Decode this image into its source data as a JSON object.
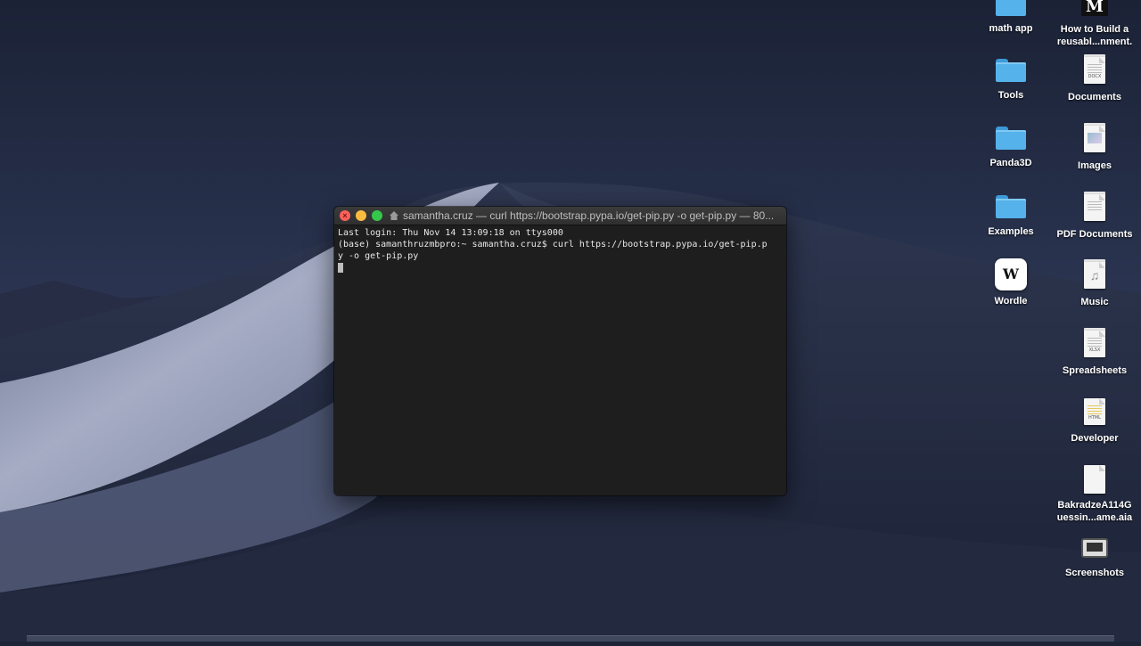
{
  "colors": {
    "sky_top": "#1b2236",
    "dune_light": "#8f98b3",
    "folder_blue": "#55b2ea",
    "terminal_bg": "#1e1e1e"
  },
  "terminal": {
    "title": "samantha.cruz — curl https://bootstrap.pypa.io/get-pip.py -o get-pip.py — 80...",
    "lines": [
      "Last login: Thu Nov 14 13:09:18 on ttys000",
      "(base) samanthruzmbpro:~ samantha.cruz$ curl https://bootstrap.pypa.io/get-pip.p",
      "y -o get-pip.py"
    ]
  },
  "desktop_icons": {
    "math_app": {
      "label": "math app",
      "icon": "folder-icon"
    },
    "medium_doc": {
      "label_line1": "How to Build a",
      "label_line2": "reusabl...nment.",
      "icon": "medium-icon",
      "glyph": "M"
    },
    "tools": {
      "label": "Tools",
      "icon": "folder-icon"
    },
    "documents": {
      "label": "Documents",
      "icon": "document-stack-icon",
      "tag": "DOCX"
    },
    "panda3d": {
      "label": "Panda3D",
      "icon": "folder-icon"
    },
    "images": {
      "label": "Images",
      "icon": "image-stack-icon"
    },
    "examples": {
      "label": "Examples",
      "icon": "folder-icon"
    },
    "pdf_documents": {
      "label": "PDF Documents",
      "icon": "document-stack-icon"
    },
    "wordle": {
      "label": "Wordle",
      "icon": "wordle-app-icon",
      "glyph": "W"
    },
    "music": {
      "label": "Music",
      "icon": "music-icon",
      "glyph": "♫"
    },
    "spreadsheets": {
      "label": "Spreadsheets",
      "icon": "spreadsheet-stack-icon",
      "tag": "XLSX"
    },
    "developer": {
      "label": "Developer",
      "icon": "html-document-icon",
      "tag": "HTML"
    },
    "bakradze": {
      "label_line1": "BakradzeA114G",
      "label_line2": "uessin...ame.aia",
      "icon": "blank-document-icon"
    },
    "screenshots": {
      "label": "Screenshots",
      "icon": "screenshot-stack-icon"
    }
  }
}
